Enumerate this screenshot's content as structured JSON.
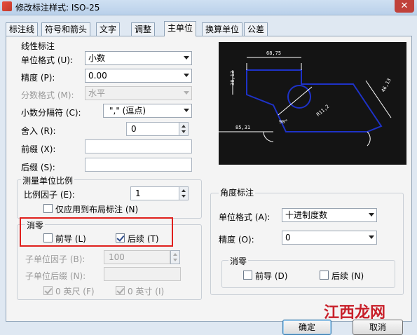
{
  "window": {
    "title": "修改标注样式: ISO-25",
    "close_glyph": "✕"
  },
  "tabs": [
    {
      "label": "标注线"
    },
    {
      "label": "符号和箭头"
    },
    {
      "label": "文字"
    },
    {
      "label": "调整"
    },
    {
      "label": "主单位"
    },
    {
      "label": "换算单位"
    },
    {
      "label": "公差"
    }
  ],
  "active_tab": "主单位",
  "linear": {
    "group_title": "线性标注",
    "unit_format_label": "单位格式 (U):",
    "unit_format_value": "小数",
    "precision_label": "精度 (P):",
    "precision_value": "0.00",
    "fraction_label": "分数格式 (M):",
    "fraction_value": "水平",
    "decimal_sep_label": "小数分隔符 (C):",
    "decimal_sep_value": "\",\" (逗点)",
    "roundoff_label": "舍入 (R):",
    "roundoff_value": "0",
    "prefix_label": "前缀 (X):",
    "prefix_value": "",
    "suffix_label": "后缀 (S):",
    "suffix_value": ""
  },
  "scale": {
    "group_title": "测量单位比例",
    "factor_label": "比例因子 (E):",
    "factor_value": "1",
    "layout_only_label": "仅应用到布局标注 (N)",
    "layout_only_checked": false
  },
  "zero_suppression": {
    "title": "消零",
    "leading_label": "前导 (L)",
    "leading_checked": false,
    "trailing_label": "后续 (T)",
    "trailing_checked": true,
    "sub_factor_label": "子单位因子 (B):",
    "sub_factor_value": "100",
    "sub_suffix_label": "子单位后缀 (N):",
    "sub_suffix_value": "",
    "feet_label": "0 英尺 (F)",
    "feet_checked": true,
    "inches_label": "0 英寸 (I)",
    "inches_checked": true
  },
  "angular": {
    "group_title": "角度标注",
    "unit_format_label": "单位格式 (A):",
    "unit_format_value": "十进制度数",
    "precision_label": "精度 (O):",
    "precision_value": "0",
    "zero_title": "消零",
    "leading_label": "前导 (D)",
    "leading_checked": false,
    "trailing_label": "后续 (N)",
    "trailing_checked": false
  },
  "preview_dims": {
    "top": "68,75",
    "left": "38,13",
    "right": "46,13",
    "diag": "R11,2",
    "bottom_left": "85,31",
    "angle": "90°"
  },
  "buttons": {
    "ok": "确定",
    "cancel": "取消"
  },
  "watermark": "江西龙网",
  "colors": {
    "highlight_box": "#e0201d",
    "preview_bg": "#141414",
    "preview_geometry": "#1e32c8",
    "preview_dims": "#ffffff"
  }
}
